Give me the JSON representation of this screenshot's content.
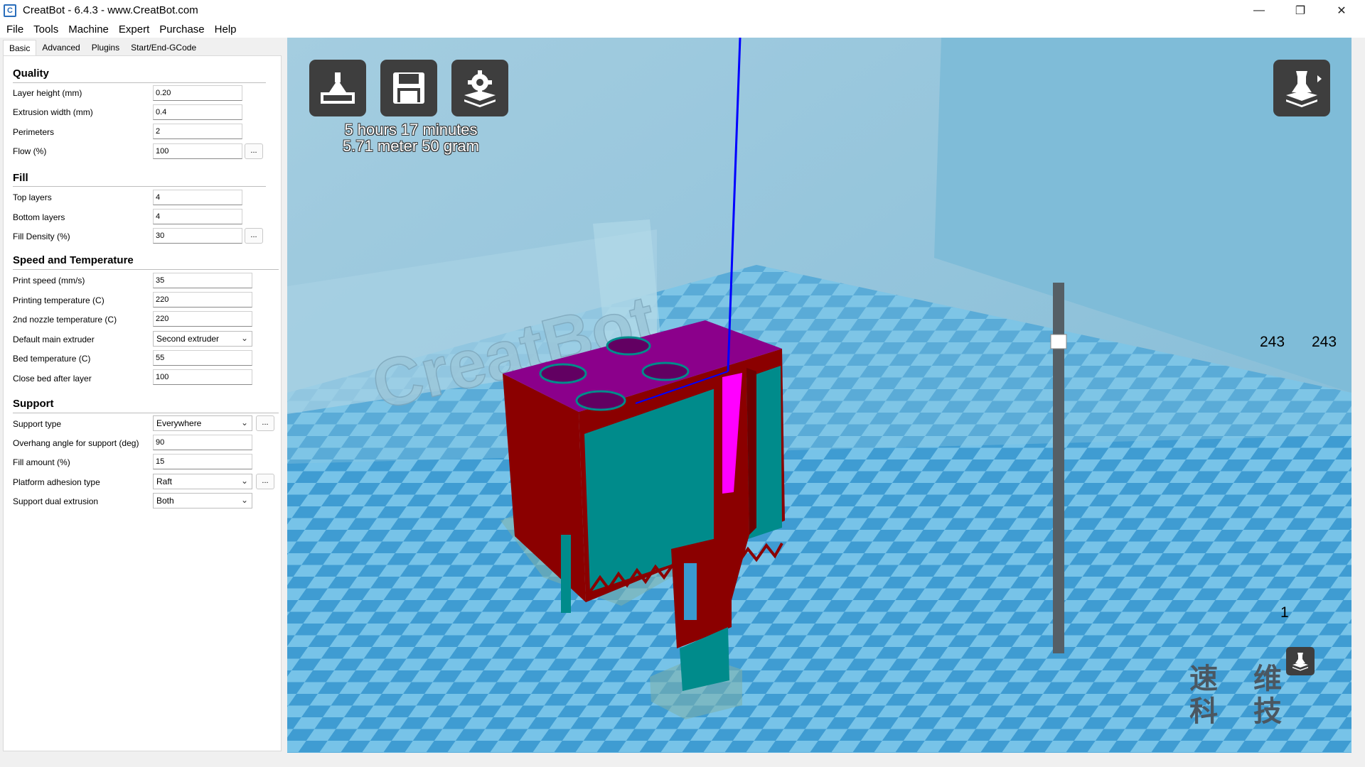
{
  "window": {
    "title": "CreatBot - 6.4.3 - www.CreatBot.com",
    "icon_letter": "C",
    "minimize": "—",
    "restore": "❐",
    "close": "✕"
  },
  "menu": [
    "File",
    "Tools",
    "Machine",
    "Expert",
    "Purchase",
    "Help"
  ],
  "tabs": [
    "Basic",
    "Advanced",
    "Plugins",
    "Start/End-GCode"
  ],
  "quality": {
    "title": "Quality",
    "layer_height_label": "Layer height (mm)",
    "layer_height": "0.20",
    "extrusion_width_label": "Extrusion width (mm)",
    "extrusion_width": "0.4",
    "perimeters_label": "Perimeters",
    "perimeters": "2",
    "flow_label": "Flow (%)",
    "flow": "100"
  },
  "fill": {
    "title": "Fill",
    "top_layers_label": "Top layers",
    "top_layers": "4",
    "bottom_layers_label": "Bottom layers",
    "bottom_layers": "4",
    "fill_density_label": "Fill Density (%)",
    "fill_density": "30"
  },
  "speed": {
    "title": "Speed and Temperature",
    "print_speed_label": "Print speed (mm/s)",
    "print_speed": "35",
    "printing_temp_label": "Printing temperature (C)",
    "printing_temp": "220",
    "nozzle2_temp_label": "2nd nozzle temperature (C)",
    "nozzle2_temp": "220",
    "main_extruder_label": "Default main extruder",
    "main_extruder": "Second extruder",
    "bed_temp_label": "Bed temperature (C)",
    "bed_temp": "55",
    "close_bed_label": "Close bed after layer",
    "close_bed": "100"
  },
  "support": {
    "title": "Support",
    "support_type_label": "Support type",
    "support_type": "Everywhere",
    "overhang_label": "Overhang angle for support (deg)",
    "overhang": "90",
    "fill_amount_label": "Fill amount (%)",
    "fill_amount": "15",
    "adhesion_label": "Platform adhesion type",
    "adhesion": "Raft",
    "dual_label": "Support dual extrusion",
    "dual": "Both"
  },
  "dots": "...",
  "viewport": {
    "print_time": "5 hours 17 minutes",
    "print_material": "5.71 meter 50 gram",
    "layer_top_left": "243",
    "layer_top_right": "243",
    "layer_bottom": "1",
    "logo_text": "CreatBot",
    "watermark_line1": "速 维",
    "watermark_line2": "科 技",
    "slider_position": 1.0
  },
  "colors": {
    "bed_light": "#77c3e8",
    "bed_dark": "#3f9cd2",
    "model_red": "#8b0000",
    "model_teal": "#008b8b",
    "model_top": "#8b008b",
    "axis_blue": "#0000ff"
  }
}
